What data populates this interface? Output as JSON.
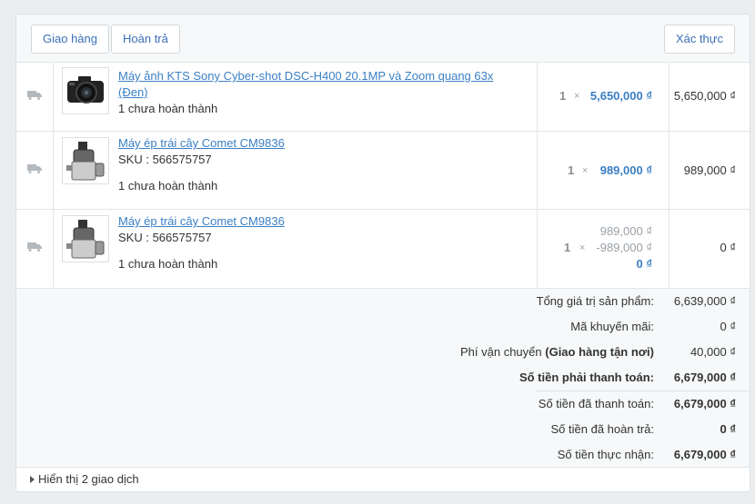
{
  "toolbar": {
    "ship_label": "Giao hàng",
    "refund_label": "Hoàn trả",
    "confirm_label": "Xác thực"
  },
  "items": [
    {
      "name_line1": "Máy ảnh KTS Sony Cyber-shot DSC-H400 20.1MP và Zoom quang 63x",
      "name_line2": "(Đen)",
      "status": "1 chưa hoàn thành",
      "qty": "1",
      "unit_price": "5,650,000 ₫",
      "total": "5,650,000 ₫",
      "icon": "camera-thumbnail"
    },
    {
      "name": "Máy ép trái cây Comet CM9836",
      "sku": "SKU : 566575757",
      "status": "1 chưa hoàn thành",
      "qty": "1",
      "unit_price": "989,000 ₫",
      "total": "989,000 ₫",
      "icon": "juicer-thumbnail"
    },
    {
      "name": "Máy ép trái cây Comet CM9836",
      "sku": "SKU : 566575757",
      "status": "1 chưa hoàn thành",
      "qty": "1",
      "orig_price": "989,000 ₫",
      "discount": "-989,000 ₫",
      "unit_price": "0 ₫",
      "total": "0 ₫",
      "icon": "juicer-thumbnail"
    }
  ],
  "summary": {
    "subtotal_label": "Tổng giá trị sản phẩm:",
    "subtotal_value": "6,639,000 ₫",
    "coupon_label": "Mã khuyến mãi:",
    "coupon_value": "0 ₫",
    "shipping_label_prefix": "Phí vận chuyển",
    "shipping_method": "(Giao hàng tận nơi)",
    "shipping_value": "40,000 ₫",
    "due_label": "Số tiền phải thanh toán:",
    "due_value": "6,679,000 ₫",
    "paid_label": "Số tiền đã thanh toán:",
    "paid_value": "6,679,000 ₫",
    "refunded_label": "Số tiền đã hoàn trả:",
    "refunded_value": "0 ₫",
    "net_label": "Số tiền thực nhận:",
    "net_value": "6,679,000 ₫"
  },
  "footer": {
    "toggle_label": "Hiển thị 2 giao dịch"
  },
  "colors": {
    "link": "#3b7fc4",
    "background": "#ebeef0",
    "panel": "#f6f8f9"
  }
}
